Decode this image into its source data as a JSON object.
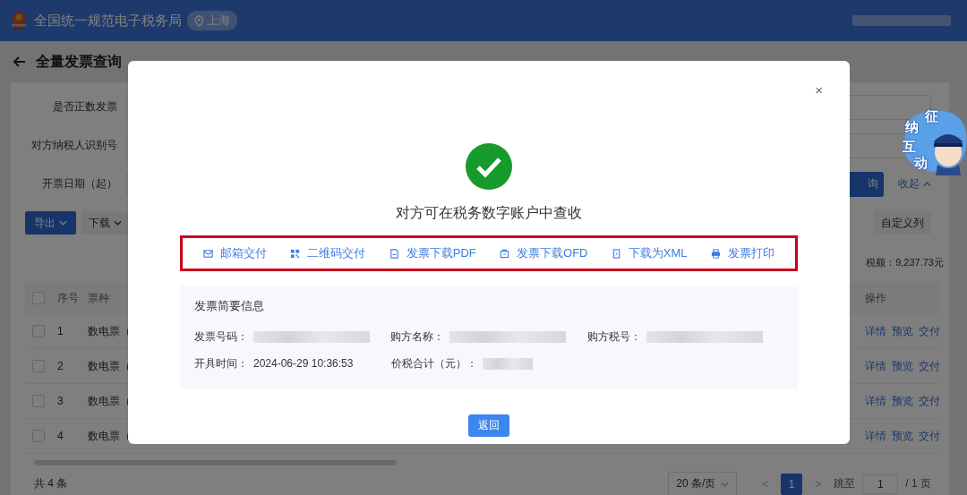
{
  "header": {
    "title": "全国统一规范电子税务局",
    "location": "上海"
  },
  "page": {
    "title": "全量发票查询"
  },
  "filters": [
    {
      "label": "是否正数发票"
    },
    {
      "label": "对方纳税人识别号"
    },
    {
      "label": "开票日期（起）"
    }
  ],
  "query_button": "询",
  "collapse": "收起",
  "toolbar": {
    "buttons": [
      {
        "label": "导出",
        "kind": "primary"
      },
      {
        "label": "下载",
        "kind": "default"
      }
    ],
    "custom_columns": "自定义列"
  },
  "summary": "税额：9,237.73元",
  "table": {
    "all_checked": false,
    "columns": [
      "序号",
      "票种"
    ],
    "action_column": "操作",
    "rows": [
      {
        "checked": false,
        "index": "1",
        "type": "数电票（",
        "actions": [
          "详情",
          "预览",
          "交付"
        ]
      },
      {
        "checked": false,
        "index": "2",
        "type": "数电票（",
        "actions": [
          "详情",
          "预览",
          "交付"
        ]
      },
      {
        "checked": false,
        "index": "3",
        "type": "数电票（",
        "actions": [
          "详情",
          "预览",
          "交付"
        ]
      },
      {
        "checked": false,
        "index": "4",
        "type": "数电票（",
        "actions": [
          "详情",
          "预览",
          "交付"
        ]
      }
    ]
  },
  "pagination": {
    "total": "共 4 条",
    "page_size": "20 条/页",
    "prev": "<",
    "page": "1",
    "next": ">",
    "jump_label": "跳至",
    "jump_value": "1",
    "pages": "/ 1 页"
  },
  "mascot": {
    "chars": [
      "征",
      "纳",
      "互",
      "动"
    ]
  },
  "dialog": {
    "close": "×",
    "message": "对方可在税务数字账户中查收",
    "actions": [
      {
        "label": "邮箱交付"
      },
      {
        "label": "二维码交付"
      },
      {
        "label": "发票下载PDF"
      },
      {
        "label": "发票下载OFD"
      },
      {
        "label": "下载为XML"
      },
      {
        "label": "发票打印"
      }
    ],
    "info": {
      "title": "发票简要信息",
      "rows": [
        [
          {
            "label": "发票号码：",
            "kind": "redacted"
          },
          {
            "label": "购方名称：",
            "kind": "redacted"
          },
          {
            "label": "购方税号：",
            "kind": "redacted"
          }
        ],
        [
          {
            "label": "开具时间：",
            "kind": "text",
            "value": "2024-06-29 10:36:53"
          },
          {
            "label": "价税合计（元）：",
            "kind": "redacted"
          }
        ]
      ]
    },
    "button": "返回"
  }
}
